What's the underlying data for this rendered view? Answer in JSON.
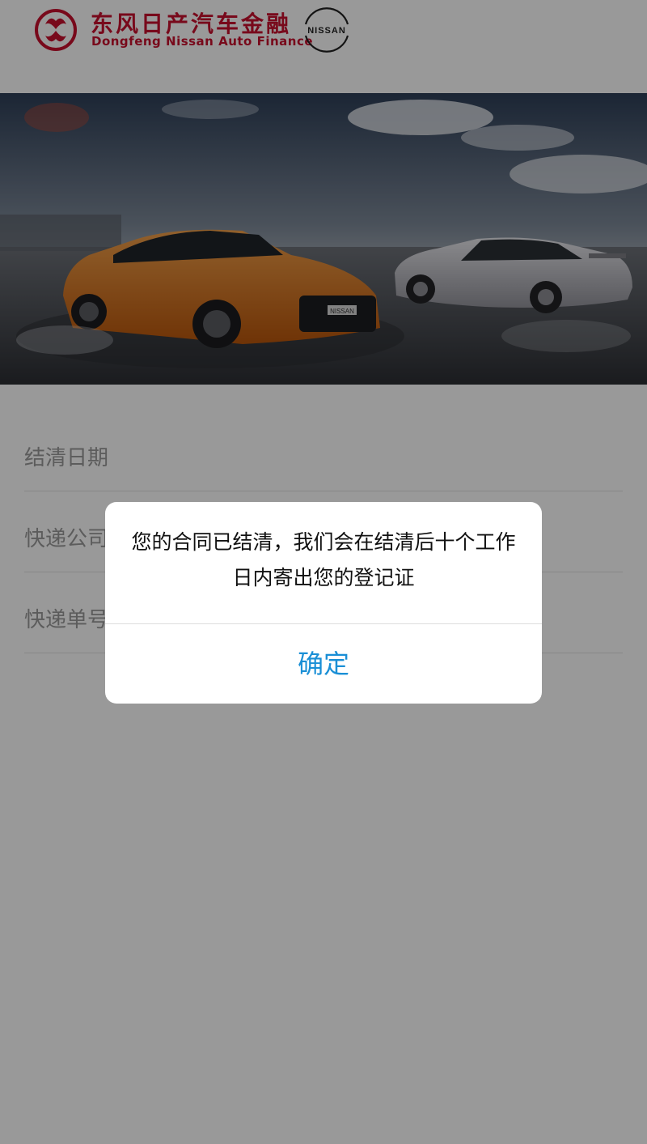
{
  "header": {
    "brand_cn": "东风日产汽车金融",
    "brand_en": "Dongfeng Nissan Auto Finance",
    "nissan_logo_text": "NISSAN",
    "car_badge_text": "NISSAN"
  },
  "form": {
    "fields": [
      {
        "label": "结清日期"
      },
      {
        "label": "快递公司"
      },
      {
        "label": "快递单号"
      }
    ]
  },
  "dialog": {
    "message": "您的合同已结清，我们会在结清后十个工作日内寄出您的登记证",
    "confirm_label": "确定"
  },
  "colors": {
    "brand_red": "#c8102e",
    "dialog_button": "#1a8fd6",
    "car_orange": "#d9761a",
    "car_silver": "#b9b9bf"
  }
}
